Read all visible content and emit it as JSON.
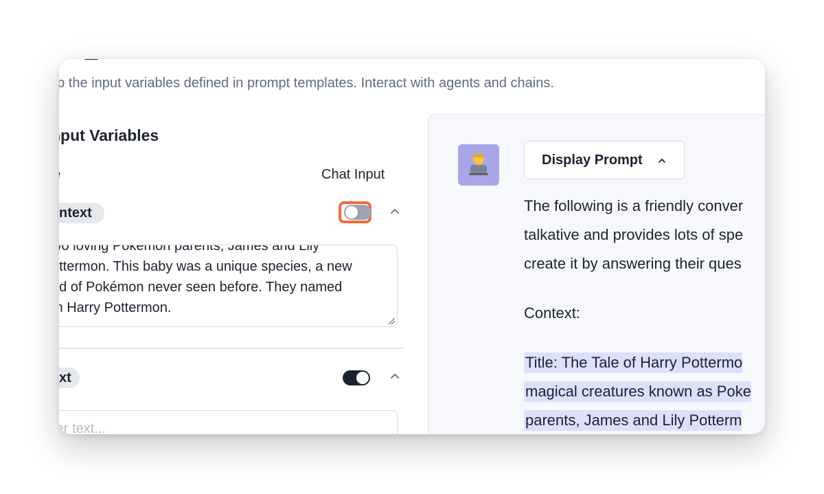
{
  "subtitle": "up the input variables defined in prompt templates. Interact with agents and chains.",
  "left_panel": {
    "title": "nput Variables",
    "col_name": "ne",
    "col_chat_input": "Chat Input",
    "variables": [
      {
        "pill": "ntext",
        "chat_input": false,
        "text_lines": [
          "wo loving Pokemon parents, James and Lily",
          "ottermon. This baby was a unique species, a new",
          "nd of Pokémon never seen before. They named",
          "m Harry Pottermon."
        ]
      },
      {
        "pill": "xt",
        "chat_input": true,
        "placeholder": "nter text..."
      }
    ]
  },
  "right_panel": {
    "display_button": "Display Prompt",
    "prompt_lines": [
      "The following is a friendly conver",
      "talkative and provides lots of spe",
      "create it by answering their ques"
    ],
    "context_label": "Context:",
    "highlight_lines": [
      "Title: The Tale of Harry Pottermo",
      "magical creatures known as Poke",
      "parents, James and Lily Potterm"
    ]
  },
  "colors": {
    "toggle_focus": "#f26b3a",
    "highlight": "#dde0fa",
    "avatar_bg": "#a9a6e8"
  },
  "icons": [
    "chevron-up-icon",
    "technologist-avatar-icon",
    "resize-handle-icon"
  ]
}
